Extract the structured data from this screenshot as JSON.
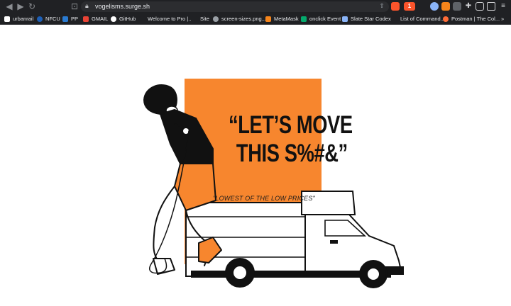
{
  "browser": {
    "url": "vogelisms.surge.sh",
    "shields_count": "1",
    "bookmarks": [
      {
        "label": "urbanrail",
        "icon": "urbanrail-icon",
        "color": "#ffffff"
      },
      {
        "label": "NFCU",
        "icon": "nfcu-icon",
        "color": "#1d5fb6"
      },
      {
        "label": "PP",
        "icon": "paypal-icon",
        "color": "#2a7bd1"
      },
      {
        "label": "GMAIL",
        "icon": "gmail-icon",
        "color": "#ea4335"
      },
      {
        "label": "GitHub",
        "icon": "github-icon",
        "color": "#ffffff"
      },
      {
        "label": "Welcome to Pro |...",
        "icon": "globe-icon",
        "color": "#202124"
      },
      {
        "label": "Site",
        "icon": "apple-icon",
        "color": "#202124"
      },
      {
        "label": "screen-sizes.png...",
        "icon": "globe-icon",
        "color": "#9aa0a6"
      },
      {
        "label": "MetaMask",
        "icon": "metamask-icon",
        "color": "#f6851b"
      },
      {
        "label": "onclick Event",
        "icon": "w3schools-icon",
        "color": "#04aa6d"
      },
      {
        "label": "Slate Star Codex",
        "icon": "ssc-icon",
        "color": "#8ab4f8"
      },
      {
        "label": "List of Command...",
        "icon": "page-icon",
        "color": "#202124"
      },
      {
        "label": "Postman | The Col...",
        "icon": "postman-icon",
        "color": "#ff6c37"
      }
    ],
    "more": "»"
  },
  "hero": {
    "headline_line1": "“LET’S MOVE",
    "headline_line2": "THIS S%#&”",
    "tagline": "\"LOWEST OF THE LOW PRICES\"",
    "accent_color": "#f7862e"
  }
}
